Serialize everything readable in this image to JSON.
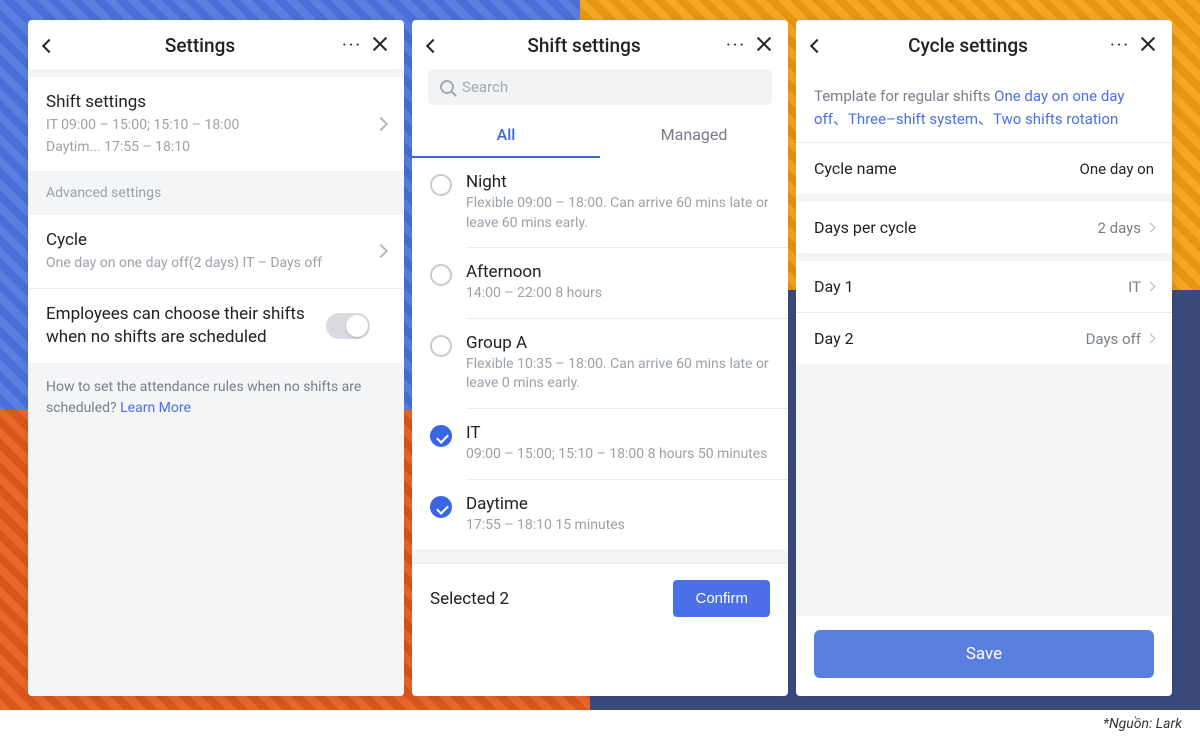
{
  "source_footer": "*Nguồn: Lark",
  "panel1": {
    "title": "Settings",
    "shift_settings_label": "Shift settings",
    "shift_settings_line1": "IT   09:00 – 15:00; 15:10 – 18:00",
    "shift_settings_line2": "Daytim...   17:55 – 18:10",
    "advanced_label": "Advanced settings",
    "cycle_label": "Cycle",
    "cycle_sub": "One day on one day off(2 days) IT – Days off",
    "employee_choose_label": "Employees can choose their shifts when no shifts are scheduled",
    "info_text": "How to set the attendance rules when no shifts are scheduled? ",
    "learn_more": "Learn More"
  },
  "panel2": {
    "title": "Shift settings",
    "search_placeholder": "Search",
    "tab_all": "All",
    "tab_managed": "Managed",
    "shifts": [
      {
        "name": "Night",
        "desc": "Flexible 09:00 – 18:00. Can arrive 60 mins late or leave 60 mins early.",
        "checked": false
      },
      {
        "name": "Afternoon",
        "desc": "14:00 – 22:00 8 hours",
        "checked": false
      },
      {
        "name": "Group A",
        "desc": "Flexible 10:35 – 18:00. Can arrive 60 mins late or leave 0 mins early.",
        "checked": false
      },
      {
        "name": "IT",
        "desc": "09:00 – 15:00; 15:10 – 18:00 8 hours 50 minutes",
        "checked": true
      },
      {
        "name": "Daytime",
        "desc": "17:55 – 18:10 15 minutes",
        "checked": true
      }
    ],
    "selected_text": "Selected 2",
    "confirm": "Confirm"
  },
  "panel3": {
    "title": "Cycle settings",
    "template_prefix": "Template for regular shifts ",
    "template_links": "One day on one day off、Three–shift system、Two shifts rotation",
    "cycle_name_label": "Cycle name",
    "cycle_name_value": "One day on",
    "days_per_cycle_label": "Days per cycle",
    "days_per_cycle_value": "2 days",
    "day1_label": "Day 1",
    "day1_value": "IT",
    "day2_label": "Day 2",
    "day2_value": "Days off",
    "save": "Save"
  }
}
